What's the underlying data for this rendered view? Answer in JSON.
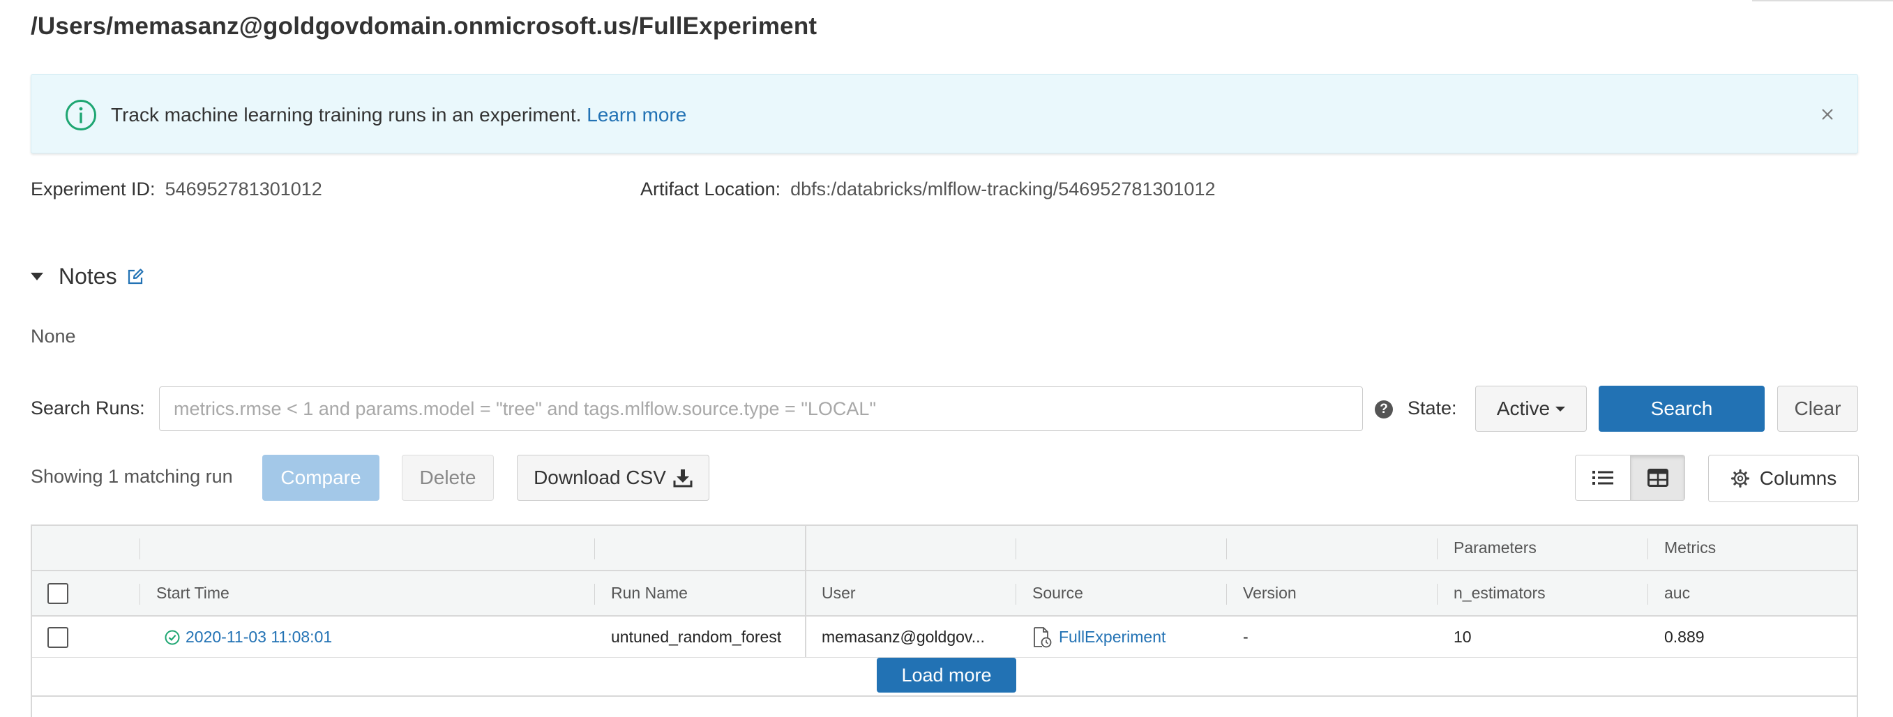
{
  "page": {
    "title": "/Users/memasanz@goldgovdomain.onmicrosoft.us/FullExperiment"
  },
  "banner": {
    "text": "Track machine learning training runs in an experiment.",
    "link": "Learn more"
  },
  "experiment": {
    "id_label": "Experiment ID:",
    "id_value": "546952781301012",
    "artifact_label": "Artifact Location:",
    "artifact_value": "dbfs:/databricks/mlflow-tracking/546952781301012"
  },
  "notes": {
    "title": "Notes",
    "body": "None"
  },
  "search": {
    "label": "Search Runs:",
    "placeholder": "metrics.rmse < 1 and params.model = \"tree\" and tags.mlflow.source.type = \"LOCAL\"",
    "help": "?",
    "state_label": "State:",
    "state_value": "Active",
    "search_button": "Search",
    "clear_button": "Clear"
  },
  "toolbar": {
    "showing": "Showing 1 matching run",
    "compare": "Compare",
    "delete": "Delete",
    "download": "Download CSV",
    "columns": "Columns"
  },
  "table": {
    "group_headers": {
      "parameters": "Parameters",
      "metrics": "Metrics"
    },
    "columns": [
      "Start Time",
      "Run Name",
      "User",
      "Source",
      "Version",
      "n_estimators",
      "auc"
    ],
    "rows": [
      {
        "start_time": "2020-11-03 11:08:01",
        "run_name": "untuned_random_forest",
        "user": "memasanz@goldgov...",
        "source": "FullExperiment",
        "version": "-",
        "n_estimators": "10",
        "auc": "0.889"
      }
    ],
    "load_more": "Load more"
  },
  "colors": {
    "accent": "#2272b4",
    "banner_bg": "#eaf8fc",
    "success": "#1ea672",
    "compare_disabled": "#a3c8e8"
  },
  "icons": [
    "info-icon",
    "close-icon",
    "edit-icon",
    "help-icon",
    "download-icon",
    "list-view-icon",
    "grid-view-icon",
    "gear-icon",
    "success-check-icon",
    "notebook-icon"
  ]
}
